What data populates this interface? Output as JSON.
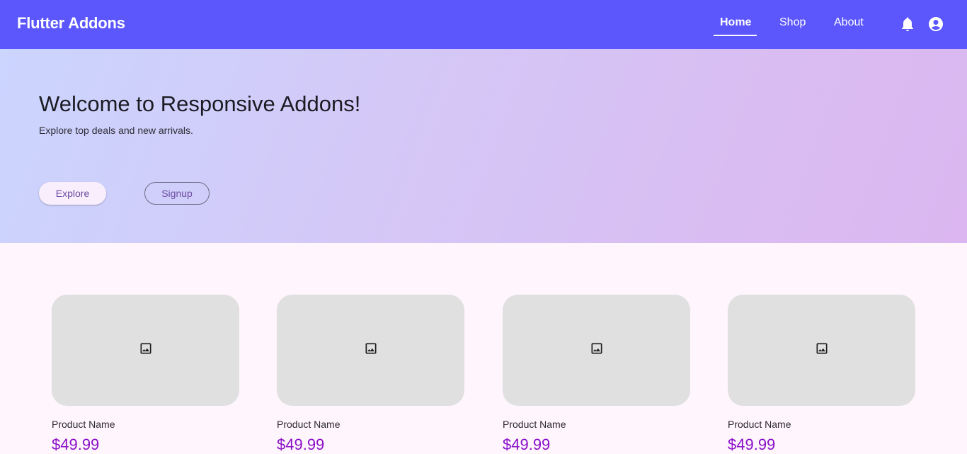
{
  "appbar": {
    "title": "Flutter Addons",
    "nav": [
      {
        "label": "Home",
        "active": true
      },
      {
        "label": "Shop",
        "active": false
      },
      {
        "label": "About",
        "active": false
      }
    ],
    "icons": [
      "bell-icon",
      "account-circle-icon"
    ]
  },
  "hero": {
    "title": "Welcome to Responsive Addons!",
    "subtitle": "Explore top deals and new arrivals.",
    "explore_label": "Explore",
    "signup_label": "Signup"
  },
  "products": [
    {
      "name": "Product Name",
      "price": "$49.99",
      "icon": "image-icon"
    },
    {
      "name": "Product Name",
      "price": "$49.99",
      "icon": "image-icon"
    },
    {
      "name": "Product Name",
      "price": "$49.99",
      "icon": "image-icon"
    },
    {
      "name": "Product Name",
      "price": "$49.99",
      "icon": "image-icon"
    }
  ],
  "colors": {
    "appbar": "#5b57fc",
    "price": "#8a10c8",
    "background": "#fff5fd"
  }
}
